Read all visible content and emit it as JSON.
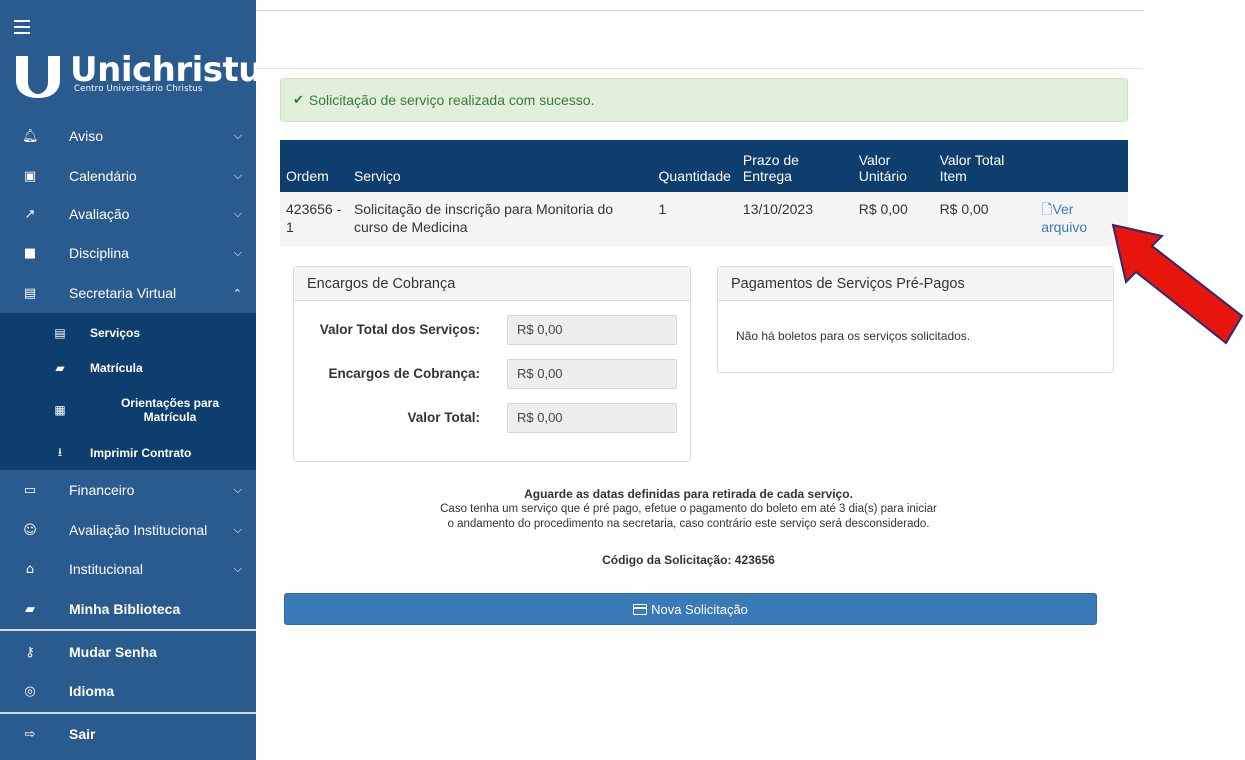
{
  "sidebar": {
    "logo": {
      "name": "Unichristus",
      "subtitle": "Centro Universitário Christus"
    },
    "items": [
      {
        "label": "Aviso",
        "icon": "bell-icon"
      },
      {
        "label": "Calendário",
        "icon": "calendar-icon"
      },
      {
        "label": "Avaliação",
        "icon": "chart-line-icon"
      },
      {
        "label": "Disciplina",
        "icon": "book-open-icon"
      },
      {
        "label": "Secretaria Virtual",
        "icon": "file-icon"
      }
    ],
    "subitems": [
      {
        "label": "Serviços",
        "icon": "file-text-icon"
      },
      {
        "label": "Matrícula",
        "icon": "book-icon"
      },
      {
        "label": "Orientações para Matrícula",
        "icon": "calendar-grid-icon"
      },
      {
        "label": "Imprimir Contrato",
        "icon": "download-icon"
      }
    ],
    "items2": [
      {
        "label": "Financeiro",
        "icon": "money-icon"
      },
      {
        "label": "Avaliação Institucional",
        "icon": "smile-icon"
      },
      {
        "label": "Institucional",
        "icon": "institution-icon"
      },
      {
        "label": "Minha Biblioteca",
        "icon": "book-icon"
      },
      {
        "label": "Mudar Senha",
        "icon": "key-icon"
      },
      {
        "label": "Idioma",
        "icon": "globe-icon"
      },
      {
        "label": "Sair",
        "icon": "sign-out-icon"
      }
    ]
  },
  "alert": {
    "icon": "check-icon",
    "message": "Solicitação de serviço realizada com sucesso."
  },
  "table": {
    "headers": [
      "Ordem",
      "Serviço",
      "Quantidade",
      "Prazo de Entrega",
      "Valor Unitário",
      "Valor Total Item",
      ""
    ],
    "row": {
      "ordem": "423656 - 1",
      "servico": "Solicitação de inscrição para Monitoria do curso de Medicina",
      "quantidade": "1",
      "prazo": "13/10/2023",
      "valor_unitario": "R$ 0,00",
      "valor_total": "R$ 0,00",
      "acao": "Ver arquivo"
    }
  },
  "encargos": {
    "title": "Encargos de Cobrança",
    "fields": [
      {
        "label": "Valor Total dos Serviços:",
        "value": "R$ 0,00"
      },
      {
        "label": "Encargos de Cobrança:",
        "value": "R$ 0,00"
      },
      {
        "label": "Valor Total:",
        "value": "R$ 0,00"
      }
    ]
  },
  "pagamentos": {
    "title": "Pagamentos de Serviços Pré-Pagos",
    "message": "Não há boletos para os serviços solicitados."
  },
  "notice": {
    "line1": "Aguarde as datas definidas para retirada de cada serviço.",
    "line2": "Caso tenha um serviço que é pré pago, efetue o pagamento do boleto em até 3 dia(s) para iniciar",
    "line3": "o andamento do procedimento na secretaria, caso contrário este serviço será desconsiderado."
  },
  "codigo": "Código da Solicitação: 423656",
  "button": {
    "label": "Nova Solicitação"
  },
  "colors": {
    "sidebar": "#2a5b8e",
    "sidebar_active": "#0d3e6e",
    "table_header": "#0d3e6e",
    "button": "#3a7ab8",
    "alert_bg": "#e1f0da",
    "arrow": "#e8150c"
  }
}
